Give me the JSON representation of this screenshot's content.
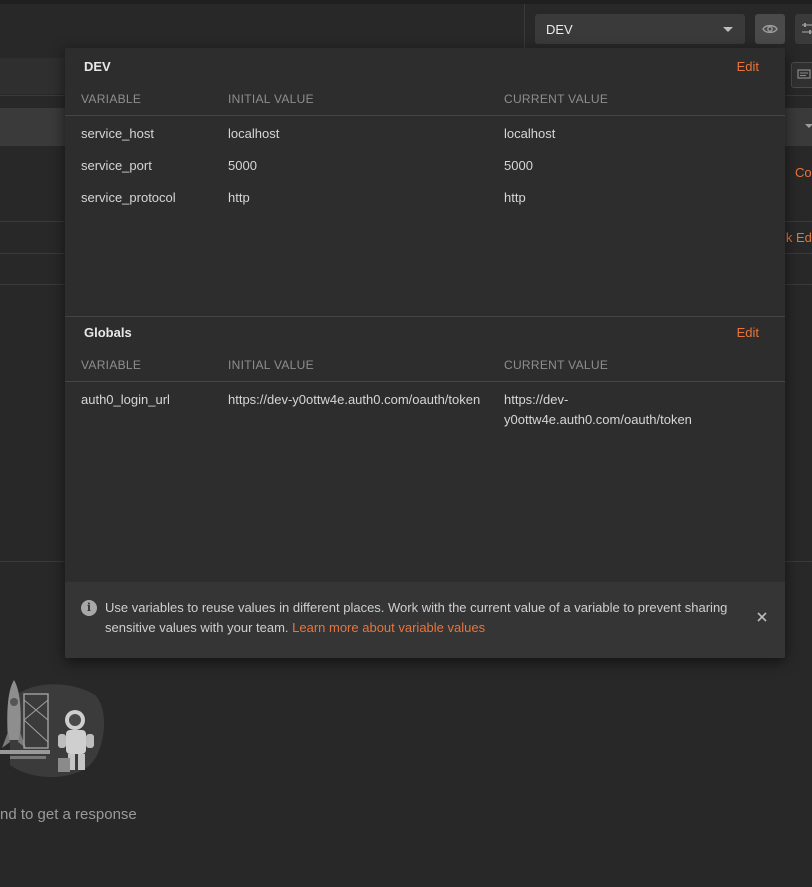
{
  "header": {
    "environment_selected": "DEV"
  },
  "background": {
    "right_link_1": "Co",
    "right_link_2": "lk Ed",
    "empty_state_text": "nd to get a response"
  },
  "environment_section": {
    "title": "DEV",
    "edit_label": "Edit",
    "columns": [
      "VARIABLE",
      "INITIAL VALUE",
      "CURRENT VALUE"
    ],
    "rows": [
      {
        "variable": "service_host",
        "initial": "localhost",
        "current": "localhost"
      },
      {
        "variable": "service_port",
        "initial": "5000",
        "current": "5000"
      },
      {
        "variable": "service_protocol",
        "initial": "http",
        "current": "http"
      }
    ]
  },
  "globals_section": {
    "title": "Globals",
    "edit_label": "Edit",
    "columns": [
      "VARIABLE",
      "INITIAL VALUE",
      "CURRENT VALUE"
    ],
    "rows": [
      {
        "variable": "auth0_login_url",
        "initial": "https://dev-y0ottw4e.auth0.com/oauth/token",
        "current": "https://dev-y0ottw4e.auth0.com/oauth/token"
      }
    ]
  },
  "info": {
    "text": "Use variables to reuse values in different places. Work with the current value of a variable to prevent sharing sensitive values with your team. ",
    "link": "Learn more about variable values"
  },
  "icons": {
    "environment_dropdown": "chevron-down-icon",
    "quick_look": "eye-icon",
    "settings": "sliders-icon",
    "comments": "comment-icon",
    "info": "info-icon",
    "close": "close-icon"
  }
}
